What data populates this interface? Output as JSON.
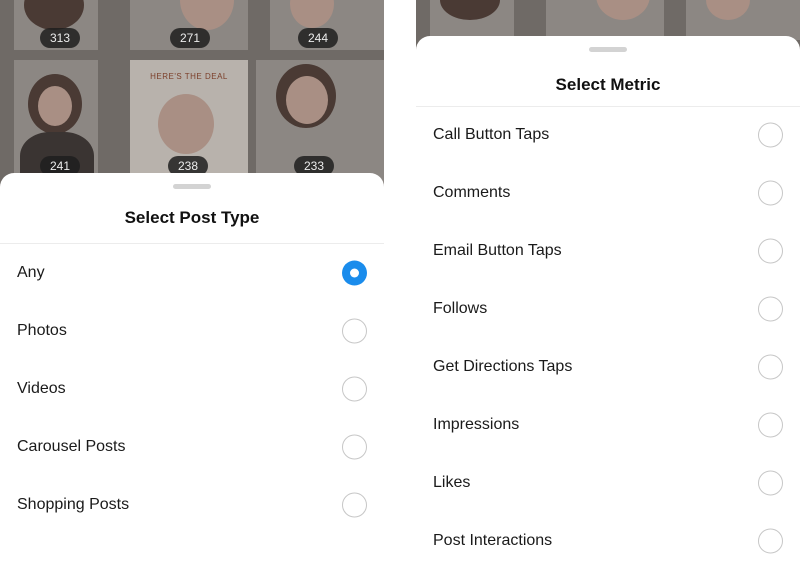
{
  "left": {
    "grid_counts": [
      "313",
      "271",
      "244",
      "241",
      "238",
      "233"
    ],
    "banner_text": "HERE'S THE DEAL",
    "sheet": {
      "title": "Select Post Type",
      "options": [
        {
          "label": "Any",
          "selected": true
        },
        {
          "label": "Photos",
          "selected": false
        },
        {
          "label": "Videos",
          "selected": false
        },
        {
          "label": "Carousel Posts",
          "selected": false
        },
        {
          "label": "Shopping Posts",
          "selected": false
        }
      ]
    }
  },
  "right": {
    "sheet": {
      "title": "Select Metric",
      "options": [
        {
          "label": "Call Button Taps",
          "selected": false
        },
        {
          "label": "Comments",
          "selected": false
        },
        {
          "label": "Email Button Taps",
          "selected": false
        },
        {
          "label": "Follows",
          "selected": false
        },
        {
          "label": "Get Directions Taps",
          "selected": false
        },
        {
          "label": "Impressions",
          "selected": false
        },
        {
          "label": "Likes",
          "selected": false
        },
        {
          "label": "Post Interactions",
          "selected": false
        }
      ]
    }
  },
  "colors": {
    "accent": "#1a8cec",
    "radio_border": "#c7c7c7"
  }
}
